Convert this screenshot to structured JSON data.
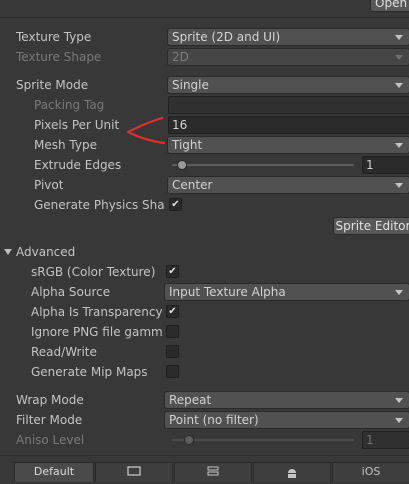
{
  "header": {
    "open_label": "Open"
  },
  "texture": {
    "type_label": "Texture Type",
    "type_value": "Sprite (2D and UI)",
    "shape_label": "Texture Shape",
    "shape_value": "2D"
  },
  "sprite": {
    "mode_label": "Sprite Mode",
    "mode_value": "Single",
    "packing_tag_label": "Packing Tag",
    "packing_tag_value": "",
    "ppu_label": "Pixels Per Unit",
    "ppu_value": "16",
    "mesh_label": "Mesh Type",
    "mesh_value": "Tight",
    "extrude_label": "Extrude Edges",
    "extrude_value": "1",
    "extrude_fraction": 0.03,
    "pivot_label": "Pivot",
    "pivot_value": "Center",
    "physics_label": "Generate Physics Shape",
    "physics_checked": true,
    "editor_button": "Sprite Editor"
  },
  "advanced": {
    "foldout_label": "Advanced",
    "srgb_label": "sRGB (Color Texture)",
    "srgb_checked": true,
    "alpha_source_label": "Alpha Source",
    "alpha_source_value": "Input Texture Alpha",
    "alpha_transp_label": "Alpha Is Transparency",
    "alpha_transp_checked": true,
    "ignore_png_label": "Ignore PNG file gamma",
    "ignore_png_checked": false,
    "readwrite_label": "Read/Write",
    "readwrite_checked": false,
    "mipmaps_label": "Generate Mip Maps",
    "mipmaps_checked": false
  },
  "wrap": {
    "wrap_label": "Wrap Mode",
    "wrap_value": "Repeat",
    "filter_label": "Filter Mode",
    "filter_value": "Point (no filter)",
    "aniso_label": "Aniso Level",
    "aniso_value": "1",
    "aniso_fraction": 0.07
  },
  "platform_tabs": [
    {
      "label": "Default",
      "icon": ""
    },
    {
      "label": "",
      "icon": "monitor-icon"
    },
    {
      "label": "",
      "icon": "server-icon"
    },
    {
      "label": "",
      "icon": "android-icon"
    },
    {
      "label": "iOS",
      "icon": ""
    }
  ],
  "annotation": {
    "color": "#e0302a"
  }
}
